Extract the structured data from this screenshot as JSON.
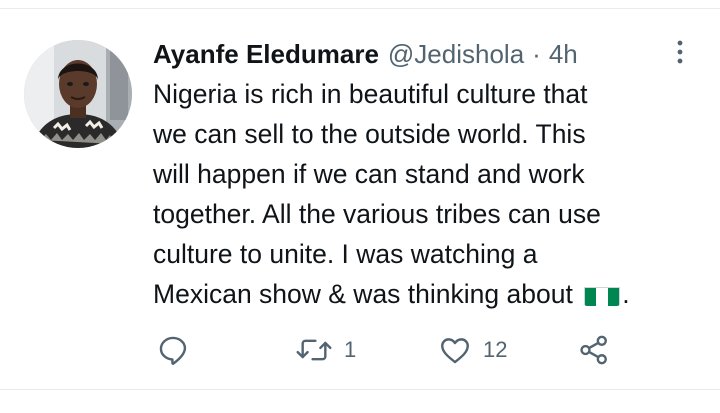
{
  "tweet": {
    "author": {
      "display_name": "Ayanfe Eledumare",
      "handle": "@Jedishola"
    },
    "separator": "·",
    "timestamp": "4h",
    "text_lines": [
      "Nigeria is rich in beautiful culture that",
      "we can sell to the outside world. This",
      "will happen if we can stand and work",
      "together. All the various tribes can use",
      "culture to unite. I was watching a",
      "Mexican show & was thinking about"
    ],
    "text_end": ".",
    "flag_emoji": "nigeria-flag",
    "stats": {
      "replies": "",
      "retweets": "1",
      "likes": "12"
    }
  },
  "colors": {
    "text_primary": "#0f1419",
    "text_secondary": "#536471",
    "divider": "#e6ecf0",
    "flag_green": "#008751",
    "flag_white": "#ffffff"
  },
  "icons": {
    "more": "more-vertical-icon",
    "reply": "reply-icon",
    "retweet": "retweet-icon",
    "like": "heart-icon",
    "share": "share-icon"
  }
}
